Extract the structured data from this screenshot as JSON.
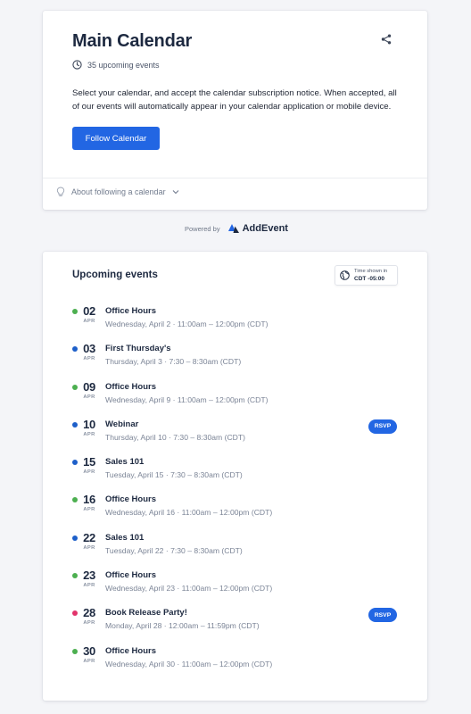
{
  "calendar": {
    "title": "Main Calendar",
    "upcoming_count_text": "35 upcoming events",
    "description": "Select your calendar, and accept the calendar subscription notice. When accepted, all of our events will automatically appear in your calendar application or mobile device.",
    "follow_button_label": "Follow Calendar",
    "about_link_label": "About following a calendar"
  },
  "powered_by": {
    "label": "Powered by",
    "brand": "AddEvent"
  },
  "events_section": {
    "title": "Upcoming events",
    "timezone_label": "Time shown in",
    "timezone_value": "CDT -05:00",
    "rsvp_label": "RSVP"
  },
  "colors": {
    "accent": "#2266e3",
    "green_dot": "#4caf50",
    "blue_dot": "#1d5fc9",
    "pink_dot": "#e2336b"
  },
  "events": [
    {
      "day": "02",
      "month": "APR",
      "title": "Office Hours",
      "time": "Wednesday, April 2 · 11:00am – 12:00pm (CDT)",
      "dot_color": "#4caf50",
      "rsvp": false
    },
    {
      "day": "03",
      "month": "APR",
      "title": "First Thursday's",
      "time": "Thursday, April 3 · 7:30 – 8:30am (CDT)",
      "dot_color": "#1d5fc9",
      "rsvp": false
    },
    {
      "day": "09",
      "month": "APR",
      "title": "Office Hours",
      "time": "Wednesday, April 9 · 11:00am – 12:00pm (CDT)",
      "dot_color": "#4caf50",
      "rsvp": false
    },
    {
      "day": "10",
      "month": "APR",
      "title": "Webinar",
      "time": "Thursday, April 10 · 7:30 – 8:30am (CDT)",
      "dot_color": "#1d5fc9",
      "rsvp": true
    },
    {
      "day": "15",
      "month": "APR",
      "title": "Sales 101",
      "time": "Tuesday, April 15 · 7:30 – 8:30am (CDT)",
      "dot_color": "#1d5fc9",
      "rsvp": false
    },
    {
      "day": "16",
      "month": "APR",
      "title": "Office Hours",
      "time": "Wednesday, April 16 · 11:00am – 12:00pm (CDT)",
      "dot_color": "#4caf50",
      "rsvp": false
    },
    {
      "day": "22",
      "month": "APR",
      "title": "Sales 101",
      "time": "Tuesday, April 22 · 7:30 – 8:30am (CDT)",
      "dot_color": "#1d5fc9",
      "rsvp": false
    },
    {
      "day": "23",
      "month": "APR",
      "title": "Office Hours",
      "time": "Wednesday, April 23 · 11:00am – 12:00pm (CDT)",
      "dot_color": "#4caf50",
      "rsvp": false
    },
    {
      "day": "28",
      "month": "APR",
      "title": "Book Release Party!",
      "time": "Monday, April 28 · 12:00am – 11:59pm (CDT)",
      "dot_color": "#e2336b",
      "rsvp": true
    },
    {
      "day": "30",
      "month": "APR",
      "title": "Office Hours",
      "time": "Wednesday, April 30 · 11:00am – 12:00pm (CDT)",
      "dot_color": "#4caf50",
      "rsvp": false
    }
  ]
}
